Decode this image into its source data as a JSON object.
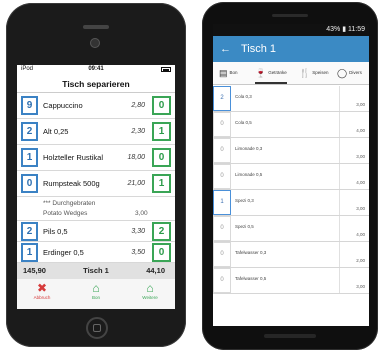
{
  "ios": {
    "status": {
      "carrier": "iPod",
      "time": "09:41"
    },
    "title": "Tisch separieren",
    "items": [
      {
        "qty": "9",
        "name": "Cappuccino",
        "price": "2,80",
        "target": "0"
      },
      {
        "qty": "2",
        "name": "Alt 0,25",
        "price": "2,30",
        "target": "1"
      },
      {
        "qty": "1",
        "name": "Holzteller Rustikal",
        "price": "18,00",
        "target": "0"
      },
      {
        "qty": "0",
        "name": "Rumpsteak 500g",
        "price": "21,00",
        "target": "1"
      }
    ],
    "note": {
      "line1": "*** Durchgebraten",
      "line2": "Potato Wedges",
      "price": "3,00"
    },
    "items2": [
      {
        "qty": "2",
        "name": "Pils 0,5",
        "price": "3,30",
        "target": "2"
      },
      {
        "qty": "1",
        "name": "Erdinger 0,5",
        "price": "3,50",
        "target": "0"
      }
    ],
    "footer": {
      "left_total": "145,90",
      "table": "Tisch 1",
      "right_total": "44,10"
    },
    "tabs": [
      {
        "label": "Abbruch",
        "icon": "close-icon",
        "glyph": "✖",
        "color": "#d63b3b"
      },
      {
        "label": "Bon",
        "icon": "house-icon",
        "glyph": "⌂",
        "color": "#3aa556"
      },
      {
        "label": "Weitere",
        "icon": "arrow-house-icon",
        "glyph": "⌂",
        "color": "#3aa556"
      }
    ]
  },
  "android": {
    "status": {
      "right": "43% ▮ 11:59"
    },
    "appbar": {
      "back": "←",
      "title": "Tisch 1"
    },
    "tabs": [
      {
        "label": "Bon",
        "icon": "receipt-icon",
        "glyph": "▤"
      },
      {
        "label": "Getränke",
        "icon": "glass-icon",
        "glyph": "🍷"
      },
      {
        "label": "Speisen",
        "icon": "cutlery-icon",
        "glyph": "🍴"
      },
      {
        "label": "Divers",
        "icon": "circle-icon",
        "glyph": "◯"
      }
    ],
    "rows": [
      {
        "qty": "2",
        "name": "Cola 0,3",
        "price": "3,00",
        "selected": true
      },
      {
        "qty": "0",
        "name": "Cola 0,5",
        "price": "4,00",
        "selected": false
      },
      {
        "qty": "0",
        "name": "Limonade 0,3",
        "price": "3,00",
        "selected": false
      },
      {
        "qty": "0",
        "name": "Limonade 0,5",
        "price": "4,00",
        "selected": false
      },
      {
        "qty": "1",
        "name": "Spezi 0,3",
        "price": "3,00",
        "selected": true
      },
      {
        "qty": "0",
        "name": "Spezi 0,5",
        "price": "4,00",
        "selected": false
      },
      {
        "qty": "0",
        "name": "Tafelwasser 0,3",
        "price": "2,00",
        "selected": false
      },
      {
        "qty": "0",
        "name": "Tafelwasser 0,5",
        "price": "3,00",
        "selected": false
      }
    ]
  }
}
